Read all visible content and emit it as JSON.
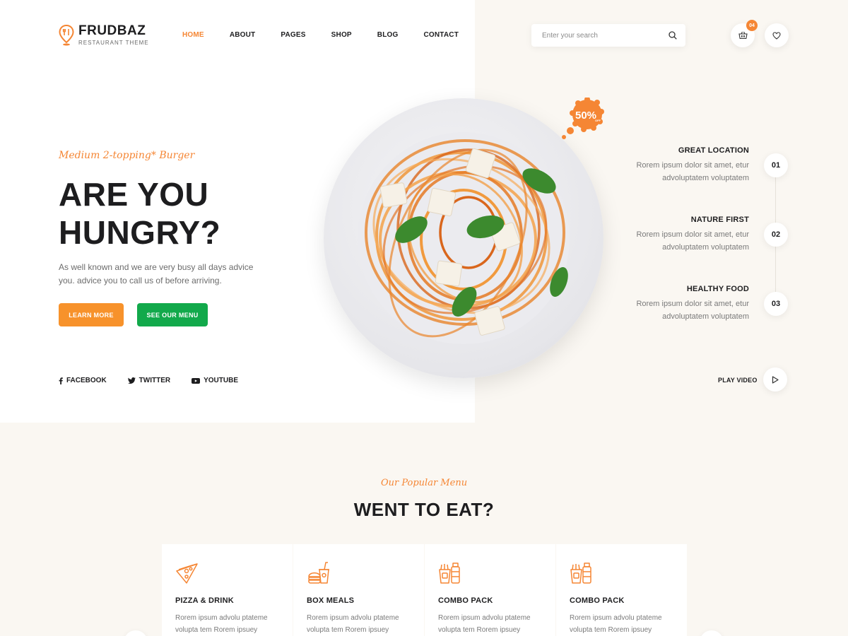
{
  "brand": {
    "name": "FRUDBAZ",
    "tagline": "RESTAURANT THEME"
  },
  "nav": {
    "items": [
      {
        "label": "HOME",
        "active": true
      },
      {
        "label": "ABOUT",
        "active": false
      },
      {
        "label": "PAGES",
        "active": false
      },
      {
        "label": "SHOP",
        "active": false
      },
      {
        "label": "BLOG",
        "active": false
      },
      {
        "label": "CONTACT",
        "active": false
      }
    ]
  },
  "search": {
    "placeholder": "Enter your search",
    "icon": "search-icon"
  },
  "cart": {
    "count": "04",
    "icon": "basket-icon"
  },
  "wishlist": {
    "icon": "heart-icon"
  },
  "hero": {
    "tag": "Medium 2-topping* Burger",
    "title_line1": "ARE YOU",
    "title_line2": "HUNGRY?",
    "description": "As well known and we are very busy all days advice you. advice you to call us of before arriving.",
    "primary_button": "LEARN MORE",
    "secondary_button": "SEE OUR MENU",
    "discount_text": "50%",
    "discount_sub": "OFF"
  },
  "socials": [
    {
      "label": "FACEBOOK",
      "icon": "facebook-icon"
    },
    {
      "label": "TWITTER",
      "icon": "twitter-icon"
    },
    {
      "label": "YOUTUBE",
      "icon": "youtube-icon"
    }
  ],
  "features": [
    {
      "title": "GREAT LOCATION",
      "desc1": "Rorem ipsum dolor sit amet, etur",
      "desc2": "advoluptatem voluptatem",
      "num": "01"
    },
    {
      "title": "NATURE FIRST",
      "desc1": "Rorem ipsum dolor sit amet, etur",
      "desc2": "advoluptatem voluptatem",
      "num": "02"
    },
    {
      "title": "HEALTHY FOOD",
      "desc1": "Rorem ipsum dolor sit amet, etur",
      "desc2": "advoluptatem voluptatem",
      "num": "03"
    }
  ],
  "play_video": {
    "label": "PLAY VIDEO",
    "icon": "play-icon"
  },
  "popular": {
    "tag": "Our Popular Menu",
    "title": "WENT TO EAT?",
    "cards": [
      {
        "title": "PIZZA & DRINK",
        "desc1": "Rorem ipsum advolu ptateme",
        "desc2": "volupta tem Rorem ipsuey",
        "icon": "pizza-slice-icon"
      },
      {
        "title": "BOX MEALS",
        "desc1": "Rorem ipsum advolu ptateme",
        "desc2": "volupta tem Rorem ipsuey",
        "icon": "burger-drink-icon"
      },
      {
        "title": "COMBO PACK",
        "desc1": "Rorem ipsum advolu ptateme",
        "desc2": "volupta tem Rorem ipsuey",
        "icon": "combo-pack-icon"
      },
      {
        "title": "COMBO PACK",
        "desc1": "Rorem ipsum advolu ptateme",
        "desc2": "volupta tem Rorem ipsuey",
        "icon": "combo-pack-icon"
      }
    ]
  },
  "colors": {
    "accent": "#f58634",
    "green": "#12a94b",
    "text": "#1d1d1f",
    "muted": "#7a7a7a",
    "cream": "#faf7f2"
  }
}
